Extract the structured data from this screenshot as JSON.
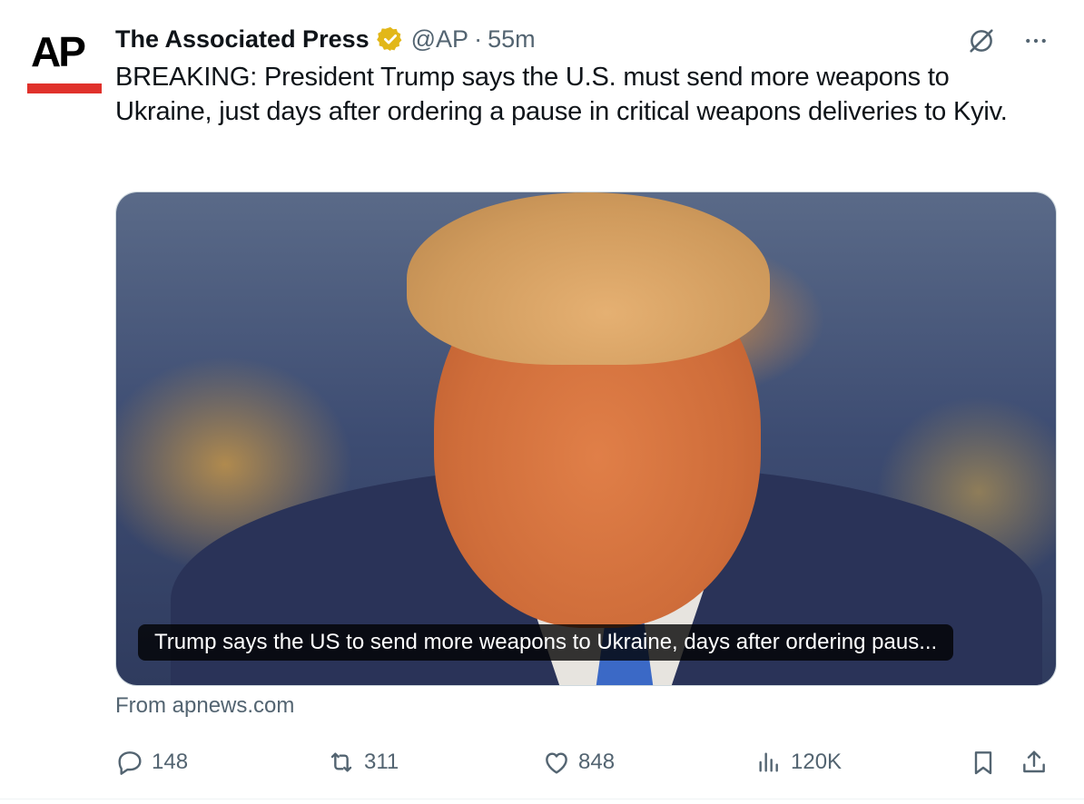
{
  "tweet": {
    "author": {
      "logo": "AP",
      "name": "The Associated Press",
      "handle": "@AP",
      "separator": "·",
      "time": "55m",
      "verified_color": "#e2b719"
    },
    "text": "BREAKING: President Trump says the U.S. must send more weapons to Ukraine, just days after ordering a pause in critical weapons deliveries to Kyiv.",
    "card": {
      "caption": "Trump says the US to send more weapons to Ukraine, days after ordering paus...",
      "source": "From apnews.com"
    },
    "stats": {
      "replies": "148",
      "retweets": "311",
      "likes": "848",
      "views": "120K"
    },
    "icons": {
      "grok": "grok-icon",
      "more": "more-icon",
      "reply": "reply-icon",
      "retweet": "retweet-icon",
      "like": "heart-icon",
      "views": "views-icon",
      "bookmark": "bookmark-icon",
      "share": "share-icon"
    },
    "colors": {
      "text": "#0f1419",
      "secondary": "#536471",
      "ap_red": "#e0312b"
    }
  }
}
